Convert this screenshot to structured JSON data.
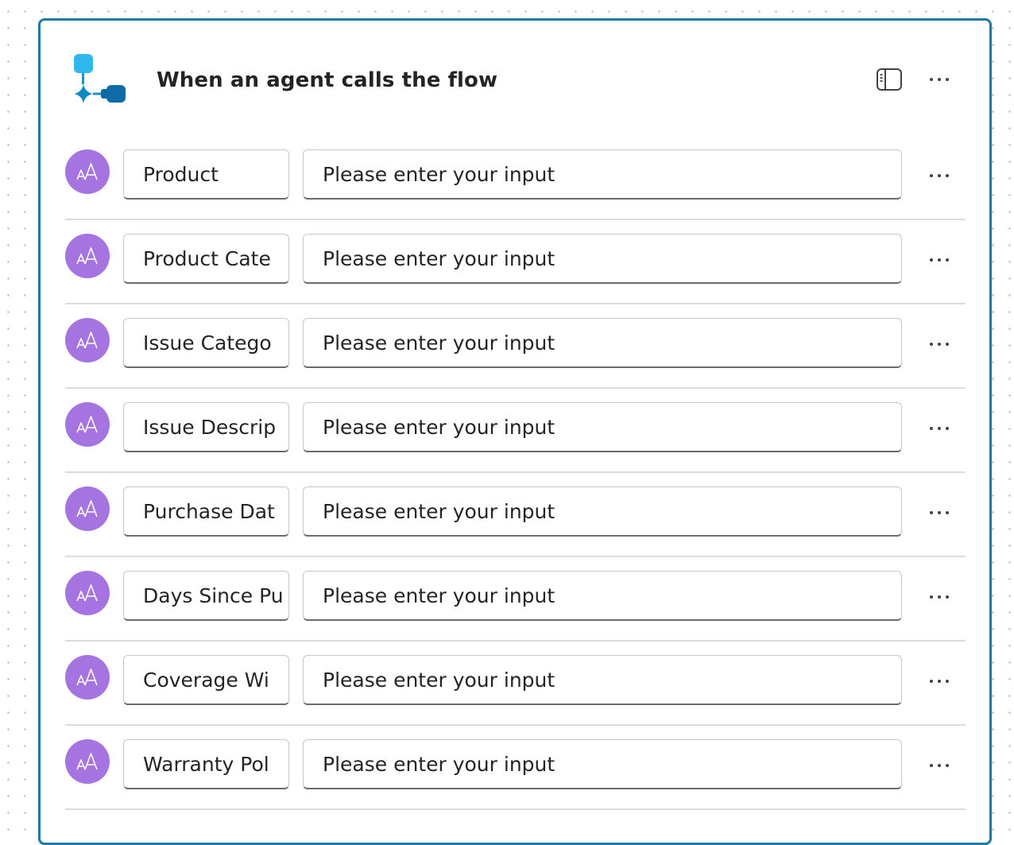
{
  "header": {
    "title": "When an agent calls the flow",
    "trigger_icon": "agent-trigger-icon",
    "panel_icon": "side-panel-icon",
    "more_icon": "more-horizontal-icon"
  },
  "colors": {
    "card_border": "#1f7aa5",
    "avatar_bg": "#a574e0",
    "icon_light_blue": "#2fb8ee",
    "icon_dark_blue": "#0f6aa8"
  },
  "inputs": [
    {
      "name": "Product",
      "placeholder": "Please enter your input",
      "type_icon": "text-type-icon"
    },
    {
      "name": "Product Cate",
      "placeholder": "Please enter your input",
      "type_icon": "text-type-icon"
    },
    {
      "name": "Issue Catego",
      "placeholder": "Please enter your input",
      "type_icon": "text-type-icon"
    },
    {
      "name": "Issue Descrip",
      "placeholder": "Please enter your input",
      "type_icon": "text-type-icon"
    },
    {
      "name": "Purchase Dat",
      "placeholder": "Please enter your input",
      "type_icon": "text-type-icon"
    },
    {
      "name": "Days Since Pu",
      "placeholder": "Please enter your input",
      "type_icon": "text-type-icon"
    },
    {
      "name": "Coverage Wi",
      "placeholder": "Please enter your input",
      "type_icon": "text-type-icon"
    },
    {
      "name": "Warranty Pol",
      "placeholder": "Please enter your input",
      "type_icon": "text-type-icon"
    }
  ]
}
